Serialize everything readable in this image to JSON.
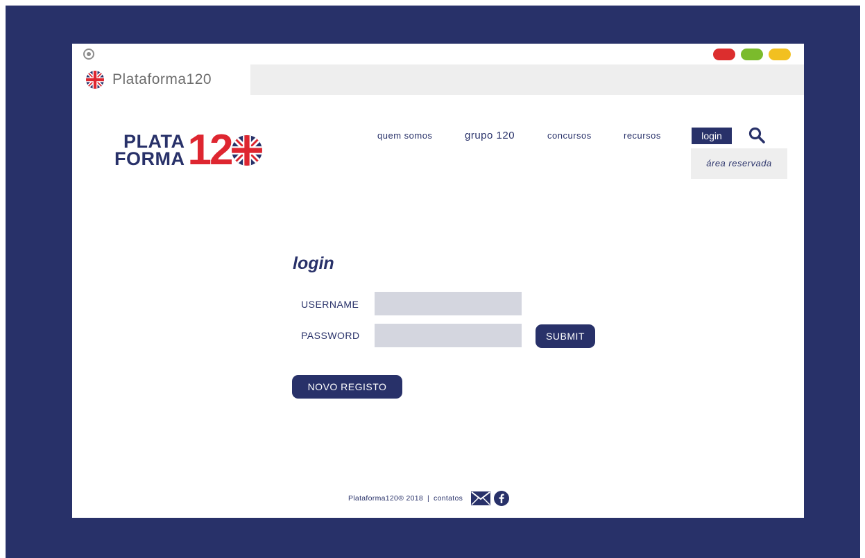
{
  "browser": {
    "tab_title": "Plataforma120"
  },
  "logo": {
    "line1": "PLATA",
    "line2": "FORMA",
    "number": "12"
  },
  "nav": {
    "items": [
      {
        "label": "quem somos"
      },
      {
        "label": "grupo 120"
      },
      {
        "label": "concursos"
      },
      {
        "label": "recursos"
      }
    ],
    "login": "login",
    "dropdown": "área reservada"
  },
  "form": {
    "title": "login",
    "username_label": "USERNAME",
    "password_label": "PASSWORD",
    "username_value": "",
    "password_value": "",
    "submit": "SUBMIT",
    "register": "NOVO REGISTO"
  },
  "footer": {
    "copyright": "Plataforma120® 2018",
    "separator": "|",
    "contacts": "contatos"
  },
  "colors": {
    "brand_navy": "#283169",
    "brand_red": "#de2630",
    "input_bg": "#d4d6df"
  },
  "icons": [
    "gear-icon",
    "uk-flag-icon",
    "search-icon",
    "mail-icon",
    "facebook-icon"
  ]
}
